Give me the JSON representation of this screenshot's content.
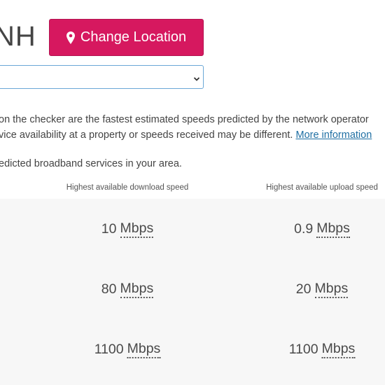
{
  "header": {
    "postcode_fragment": "NH",
    "change_location_label": "Change Location"
  },
  "address_select": {
    "selected": ""
  },
  "disclaimer": {
    "line1": "on the checker are the fastest estimated speeds predicted by the network operator",
    "line2": "vice availability at a property or speeds received may be different.",
    "more_link": "More information"
  },
  "intro_text": "edicted broadband services in your area.",
  "table": {
    "headers": {
      "download": "Highest available download speed",
      "upload": "Highest available upload speed"
    },
    "rows": [
      {
        "download_value": "10",
        "download_unit": "Mbps",
        "upload_value": "0.9",
        "upload_unit": "Mbps"
      },
      {
        "download_value": "80",
        "download_unit": "Mbps",
        "upload_value": "20",
        "upload_unit": "Mbps"
      },
      {
        "download_value": "1100",
        "download_unit": "Mbps",
        "upload_value": "1100",
        "upload_unit": "Mbps"
      }
    ]
  },
  "colors": {
    "button_bg": "#d6185f",
    "select_border": "#6aa7d6",
    "link": "#1f6fa3",
    "table_bg": "#f7f7f7"
  },
  "icons": {
    "location": "map-pin-icon",
    "select_arrow": "chevron-down-icon"
  }
}
